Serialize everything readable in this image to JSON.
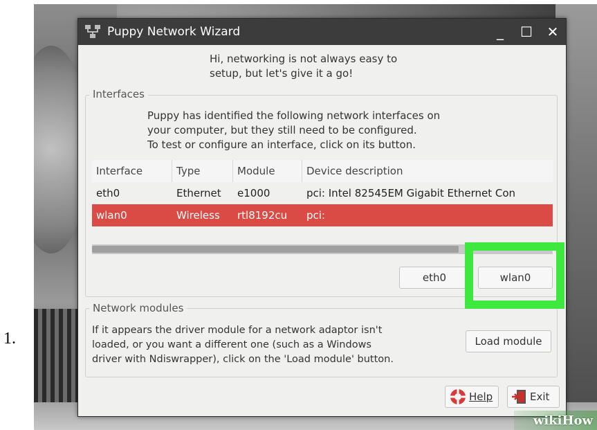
{
  "list_number": "1.",
  "window": {
    "title": "Puppy Network Wizard",
    "controls": {
      "minimize": "_",
      "maximize": "☐",
      "close": "✕"
    }
  },
  "intro": {
    "line1": "Hi, networking is not always easy to",
    "line2": "setup, but let's give it a go!"
  },
  "interfaces": {
    "group_label": "Interfaces",
    "desc_line1": "Puppy has identified the following network interfaces on",
    "desc_line2": "your computer, but they still need to be configured.",
    "desc_line3": "To test or configure an interface, click on its button.",
    "columns": [
      "Interface",
      "Type",
      "Module",
      "Device description"
    ],
    "rows": [
      {
        "interface": "eth0",
        "type": "Ethernet",
        "module": "e1000",
        "description": "pci:  Intel 82545EM Gigabit Ethernet Con"
      },
      {
        "interface": "wlan0",
        "type": "Wireless",
        "module": "rtl8192cu",
        "description": "pci:"
      }
    ],
    "buttons": {
      "eth0": "eth0",
      "wlan0": "wlan0"
    }
  },
  "modules": {
    "group_label": "Network modules",
    "desc_line1": "If it appears the driver module for a network adaptor isn't",
    "desc_line2": "loaded, or you want a different one (such as a Windows",
    "desc_line3": "driver with Ndiswrapper), click on the 'Load module' button.",
    "load_button": "Load module"
  },
  "footer": {
    "help": "Help",
    "exit": "Exit"
  },
  "watermark": {
    "wiki": "wiki",
    "how": "How"
  },
  "colors": {
    "selected_row": "#d94b44",
    "highlight": "#3ee83e",
    "titlebar": "#3c3c3c"
  }
}
